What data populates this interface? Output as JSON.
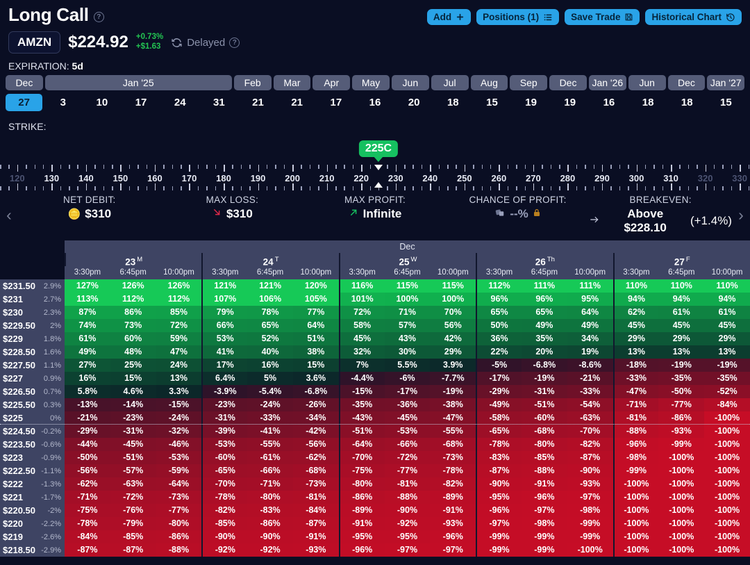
{
  "header": {
    "title": "Long Call",
    "help_icon": "question-circle-icon",
    "actions": [
      {
        "label": "Add",
        "icon": "plus-icon"
      },
      {
        "label": "Positions (1)",
        "icon": "list-icon"
      },
      {
        "label": "Save Trade",
        "icon": "save-disk-icon"
      },
      {
        "label": "Historical Chart",
        "icon": "history-clock-icon"
      }
    ]
  },
  "quote": {
    "ticker": "AMZN",
    "price": "$224.92",
    "change_pct": "+0.73%",
    "change_abs": "+$1.63",
    "change_color": "#23c552",
    "refresh_icon": "refresh-icon",
    "status": "Delayed",
    "status_help_icon": "question-circle-icon"
  },
  "expiration": {
    "label": "EXPIRATION:",
    "value": "5d",
    "months": [
      {
        "name": "Dec",
        "span": 1
      },
      {
        "name": "Jan '25",
        "span": 5
      },
      {
        "name": "Feb",
        "span": 1
      },
      {
        "name": "Mar",
        "span": 1
      },
      {
        "name": "Apr",
        "span": 1
      },
      {
        "name": "May",
        "span": 1
      },
      {
        "name": "Jun",
        "span": 1
      },
      {
        "name": "Jul",
        "span": 1
      },
      {
        "name": "Aug",
        "span": 1
      },
      {
        "name": "Sep",
        "span": 1
      },
      {
        "name": "Dec",
        "span": 1
      },
      {
        "name": "Jan '26",
        "span": 1
      },
      {
        "name": "Jun",
        "span": 1
      },
      {
        "name": "Dec",
        "span": 1
      },
      {
        "name": "Jan '27",
        "span": 1
      }
    ],
    "days": [
      "27",
      "3",
      "10",
      "17",
      "24",
      "31",
      "21",
      "21",
      "17",
      "16",
      "20",
      "18",
      "15",
      "19",
      "19",
      "16",
      "18",
      "18",
      "15"
    ],
    "selected_day_index": 0
  },
  "strike": {
    "label": "STRIKE:",
    "badge": "225C",
    "badge_color": "#16c060",
    "selected_value": 225,
    "axis_min": 115,
    "axis_max": 333,
    "major_ticks": [
      120,
      130,
      140,
      150,
      160,
      170,
      180,
      190,
      200,
      210,
      220,
      230,
      240,
      250,
      260,
      270,
      280,
      290,
      300,
      310,
      320,
      330
    ],
    "dim_ticks": [
      120,
      320,
      330
    ]
  },
  "metrics": {
    "prev_icon": "chevron-left-icon",
    "next_icon": "chevron-right-icon",
    "items": [
      {
        "label": "NET DEBIT:",
        "value": "$310",
        "icon": "coins-icon",
        "muted": false
      },
      {
        "label": "MAX LOSS:",
        "value": "$310",
        "icon": "arrow-down-right-icon",
        "muted": false
      },
      {
        "label": "MAX PROFIT:",
        "value": "Infinite",
        "icon": "arrow-up-right-icon",
        "muted": false
      },
      {
        "label": "CHANCE OF PROFIT:",
        "value": "--%",
        "icon": "dice-icon",
        "lock_icon": "lock-icon",
        "muted": true
      },
      {
        "label": "BREAKEVEN:",
        "value": "Above $228.10",
        "suffix": "(+1.4%)",
        "icon": "arrow-right-icon",
        "muted": false
      }
    ]
  },
  "table": {
    "month_header": "Dec",
    "days": [
      {
        "date": "23",
        "weekday": "M"
      },
      {
        "date": "24",
        "weekday": "T"
      },
      {
        "date": "25",
        "weekday": "W"
      },
      {
        "date": "26",
        "weekday": "Th"
      },
      {
        "date": "27",
        "weekday": "F"
      }
    ],
    "times": [
      "3:30pm",
      "6:45pm",
      "10:00pm"
    ],
    "separator_after_strike": "$225",
    "rows": [
      {
        "strike": "$231.50",
        "pct": "2.9%",
        "values": [
          127,
          126,
          126,
          121,
          121,
          120,
          116,
          115,
          115,
          112,
          111,
          111,
          110,
          110,
          110
        ]
      },
      {
        "strike": "$231",
        "pct": "2.7%",
        "values": [
          113,
          112,
          112,
          107,
          106,
          105,
          101,
          100,
          100,
          96,
          96,
          95,
          94,
          94,
          94
        ]
      },
      {
        "strike": "$230",
        "pct": "2.3%",
        "values": [
          87,
          86,
          85,
          79,
          78,
          77,
          72,
          71,
          70,
          65,
          65,
          64,
          62,
          61,
          61
        ]
      },
      {
        "strike": "$229.50",
        "pct": "2%",
        "values": [
          74,
          73,
          72,
          66,
          65,
          64,
          58,
          57,
          56,
          50,
          49,
          49,
          45,
          45,
          45
        ]
      },
      {
        "strike": "$229",
        "pct": "1.8%",
        "values": [
          61,
          60,
          59,
          53,
          52,
          51,
          45,
          43,
          42,
          36,
          35,
          34,
          29,
          29,
          29
        ]
      },
      {
        "strike": "$228.50",
        "pct": "1.6%",
        "values": [
          49,
          48,
          47,
          41,
          40,
          38,
          32,
          30,
          29,
          22,
          20,
          19,
          13,
          13,
          13
        ]
      },
      {
        "strike": "$227.50",
        "pct": "1.1%",
        "values": [
          27,
          25,
          24,
          17,
          16,
          15,
          7,
          5.5,
          3.9,
          -5,
          -6.8,
          -8.6,
          -18,
          -19,
          -19
        ]
      },
      {
        "strike": "$227",
        "pct": "0.9%",
        "values": [
          16,
          15,
          13,
          6.4,
          5,
          3.6,
          -4.4,
          -6,
          -7.7,
          -17,
          -19,
          -21,
          -33,
          -35,
          -35
        ]
      },
      {
        "strike": "$226.50",
        "pct": "0.7%",
        "values": [
          5.8,
          4.6,
          3.3,
          -3.9,
          -5.4,
          -6.8,
          -15,
          -17,
          -19,
          -29,
          -31,
          -33,
          -47,
          -50,
          -52
        ]
      },
      {
        "strike": "$225.50",
        "pct": "0.3%",
        "values": [
          -13,
          -14,
          -15,
          -23,
          -24,
          -26,
          -35,
          -36,
          -38,
          -49,
          -51,
          -54,
          -71,
          -77,
          -84
        ]
      },
      {
        "strike": "$225",
        "pct": "0%",
        "values": [
          -21,
          -23,
          -24,
          -31,
          -33,
          -34,
          -43,
          -45,
          -47,
          -58,
          -60,
          -63,
          -81,
          -86,
          -100
        ]
      },
      {
        "strike": "$224.50",
        "pct": "-0.2%",
        "values": [
          -29,
          -31,
          -32,
          -39,
          -41,
          -42,
          -51,
          -53,
          -55,
          -65,
          -68,
          -70,
          -88,
          -93,
          -100
        ]
      },
      {
        "strike": "$223.50",
        "pct": "-0.6%",
        "values": [
          -44,
          -45,
          -46,
          -53,
          -55,
          -56,
          -64,
          -66,
          -68,
          -78,
          -80,
          -82,
          -96,
          -99,
          -100
        ]
      },
      {
        "strike": "$223",
        "pct": "-0.9%",
        "values": [
          -50,
          -51,
          -53,
          -60,
          -61,
          -62,
          -70,
          -72,
          -73,
          -83,
          -85,
          -87,
          -98,
          -100,
          -100
        ]
      },
      {
        "strike": "$222.50",
        "pct": "-1.1%",
        "values": [
          -56,
          -57,
          -59,
          -65,
          -66,
          -68,
          -75,
          -77,
          -78,
          -87,
          -88,
          -90,
          -99,
          -100,
          -100
        ]
      },
      {
        "strike": "$222",
        "pct": "-1.3%",
        "values": [
          -62,
          -63,
          -64,
          -70,
          -71,
          -73,
          -80,
          -81,
          -82,
          -90,
          -91,
          -93,
          -100,
          -100,
          -100
        ]
      },
      {
        "strike": "$221",
        "pct": "-1.7%",
        "values": [
          -71,
          -72,
          -73,
          -78,
          -80,
          -81,
          -86,
          -88,
          -89,
          -95,
          -96,
          -97,
          -100,
          -100,
          -100
        ]
      },
      {
        "strike": "$220.50",
        "pct": "-2%",
        "values": [
          -75,
          -76,
          -77,
          -82,
          -83,
          -84,
          -89,
          -90,
          -91,
          -96,
          -97,
          -98,
          -100,
          -100,
          -100
        ]
      },
      {
        "strike": "$220",
        "pct": "-2.2%",
        "values": [
          -78,
          -79,
          -80,
          -85,
          -86,
          -87,
          -91,
          -92,
          -93,
          -97,
          -98,
          -99,
          -100,
          -100,
          -100
        ]
      },
      {
        "strike": "$219",
        "pct": "-2.6%",
        "values": [
          -84,
          -85,
          -86,
          -90,
          -90,
          -91,
          -95,
          -95,
          -96,
          -99,
          -99,
          -99,
          -100,
          -100,
          -100
        ]
      },
      {
        "strike": "$218.50",
        "pct": "-2.9%",
        "values": [
          -87,
          -87,
          -88,
          -92,
          -92,
          -93,
          -96,
          -97,
          -97,
          -99,
          -99,
          -100,
          -100,
          -100,
          -100
        ]
      }
    ]
  }
}
